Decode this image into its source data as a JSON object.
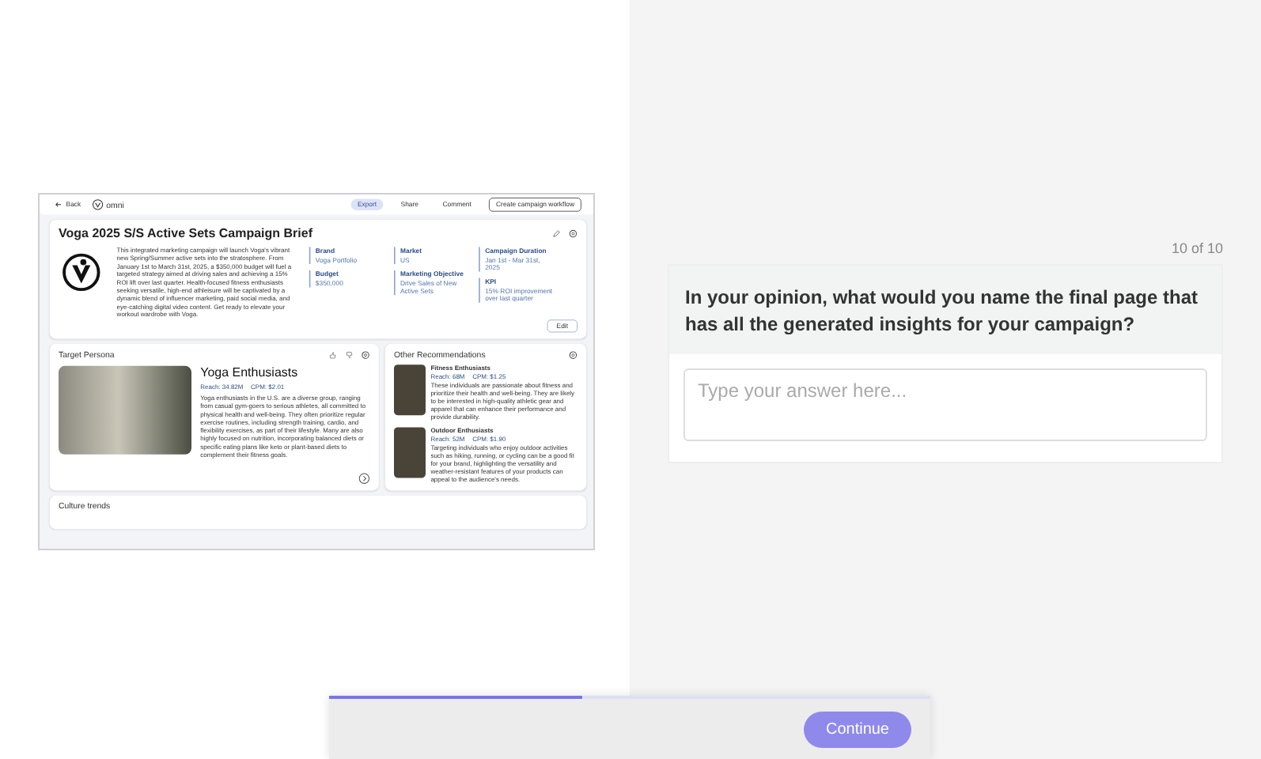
{
  "preview": {
    "topbar": {
      "back": "Back",
      "logo": "omni",
      "actions": [
        {
          "label": "Export",
          "selected": true
        },
        {
          "label": "Share",
          "selected": false
        },
        {
          "label": "Comment",
          "selected": false
        }
      ],
      "primary": "Create campaign workflow"
    },
    "brief": {
      "title": "Voga 2025 S/S Active Sets Campaign Brief",
      "summary": "This integrated marketing campaign will launch Voga's vibrant new Spring/Summer active sets into the stratosphere. From January 1st to March 31st, 2025, a $350,000 budget will fuel a targeted strategy aimed at driving sales and achieving a 15% ROI lift over last quarter. Health-focused fitness enthusiasts seeking versatile, high-end athleisure will be captivated by a dynamic blend of influencer marketing, paid social media, and eye-catching digital video content. Get ready to elevate your workout wardrobe with Voga.",
      "fields": [
        [
          {
            "label": "Brand",
            "value": "Voga Portfolio"
          },
          {
            "label": "Budget",
            "value": "$350,000"
          }
        ],
        [
          {
            "label": "Market",
            "value": "US"
          },
          {
            "label": "Marketing Objective",
            "value": "Drive Sales of New Active Sets"
          }
        ],
        [
          {
            "label": "Campaign Duration",
            "value": "Jan 1st - Mar 31st, 2025"
          },
          {
            "label": "KPI",
            "value": "15% ROI improvement over last quarter"
          }
        ]
      ],
      "edit": "Edit"
    },
    "persona": {
      "heading": "Target Persona",
      "name": "Yoga Enthusiasts",
      "reach": "Reach: 34.82M",
      "cpm": "CPM: $2.01",
      "description": "Yoga enthusiasts in the U.S. are a diverse group, ranging from casual gym-goers to serious athletes, all committed to physical health and well-being. They often prioritize regular exercise routines, including strength training, cardio, and flexibility exercises, as part of their lifestyle. Many are also highly focused on nutrition, incorporating balanced diets or specific eating plans like keto or plant-based diets to complement their fitness goals."
    },
    "recommendations": {
      "heading": "Other Recommendations",
      "items": [
        {
          "name": "Fitness Enthusiasts",
          "reach": "Reach: 68M",
          "cpm": "CPM: $1.25",
          "description": "These individuals are passionate about fitness and prioritize their health and well-being. They are likely to be interested in high-quality athletic gear and apparel that can enhance their performance and provide durability."
        },
        {
          "name": "Outdoor Enthusiasts",
          "reach": "Reach: 52M",
          "cpm": "CPM: $1.90",
          "description": "Targeting individuals who enjoy outdoor activities such as hiking, running, or cycling can be a good fit for your brand, highlighting the versatility and weather-resistant features of your products can appeal to the audience's needs."
        }
      ]
    },
    "next_section": "Culture trends"
  },
  "survey": {
    "counter": "10 of 10",
    "question": "In your opinion, what would you name the final page that has all the generated insights for your campaign?",
    "answer": {
      "placeholder": "Type your answer here..."
    }
  },
  "footer": {
    "progress": {
      "level": 0.42
    },
    "continue": {
      "label": "Continue",
      "disabled": true
    }
  }
}
